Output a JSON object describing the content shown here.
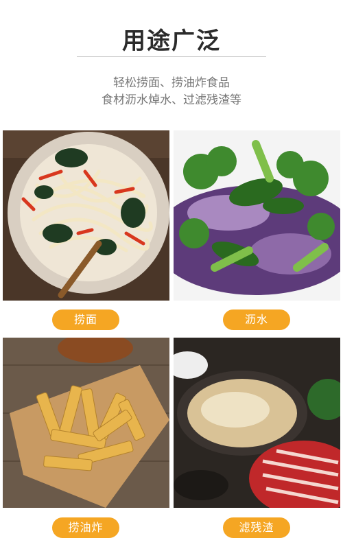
{
  "header": {
    "title": "用途广泛",
    "subtitle_line1": "轻松捞面、捞油炸食品",
    "subtitle_line2": "食材沥水焯水、过滤残渣等"
  },
  "cards": [
    {
      "label": "捞面",
      "image": "noodle-dish-photo"
    },
    {
      "label": "沥水",
      "image": "vegetables-photo"
    },
    {
      "label": "捞油炸",
      "image": "french-fries-photo"
    },
    {
      "label": "滤残渣",
      "image": "hotpot-photo"
    }
  ],
  "colors": {
    "pill": "#f5a623",
    "title": "#2b2b2b",
    "subtitle": "#777777"
  }
}
